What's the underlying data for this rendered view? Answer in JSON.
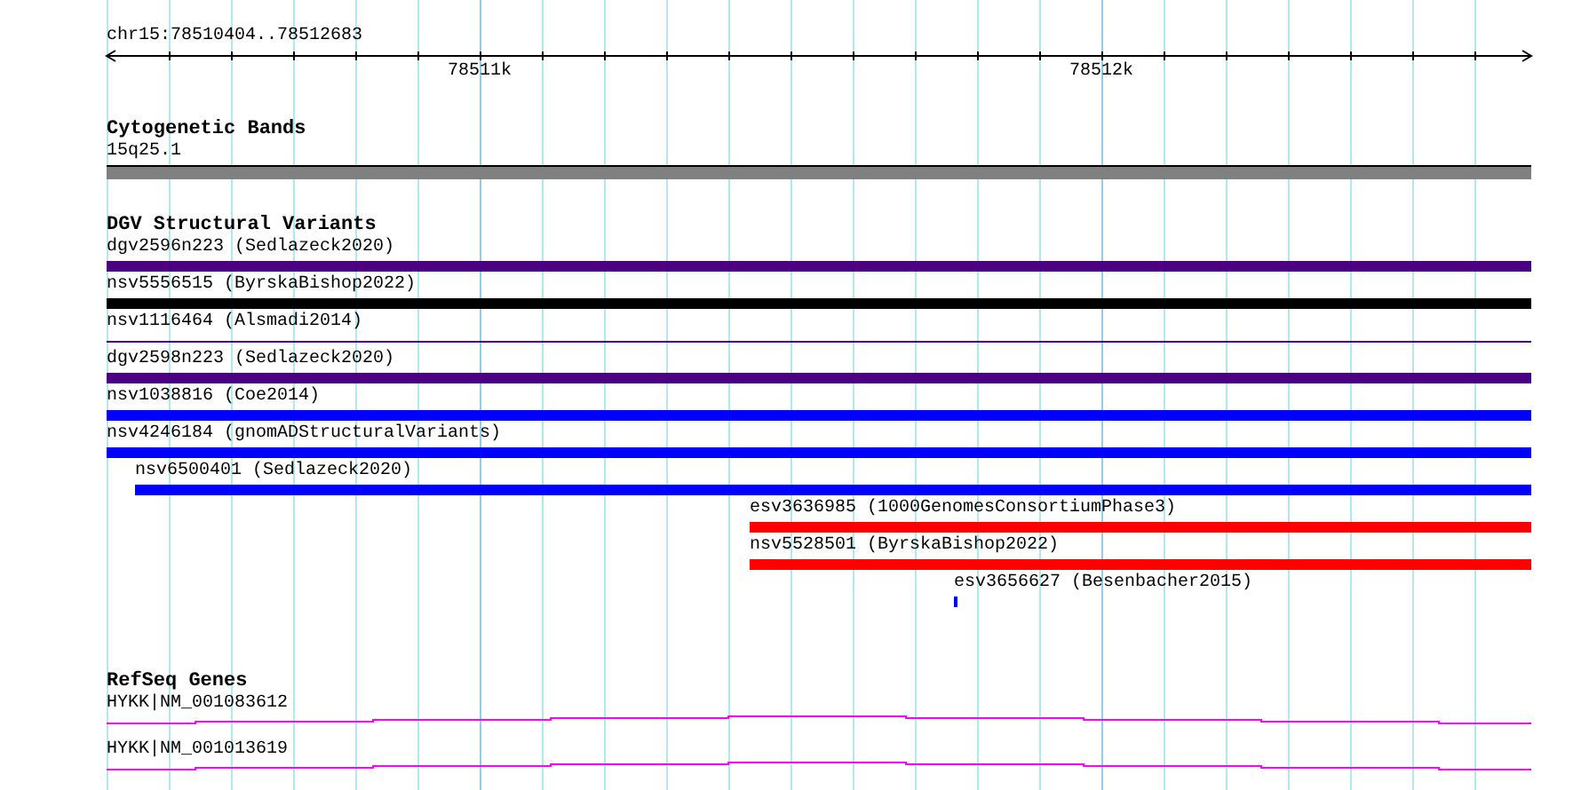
{
  "ruler": {
    "range_label": "chr15:78510404..78512683",
    "tick_labels": [
      "78511k",
      "78512k"
    ]
  },
  "tracks": [
    {
      "title": "Cytogenetic Bands",
      "kind": "bands",
      "features": [
        {
          "label": "15q25.1",
          "kind": "band",
          "color": "#808080"
        }
      ]
    },
    {
      "title": "DGV Structural Variants",
      "kind": "variants",
      "features": [
        {
          "label": "dgv2596n223 (Sedlazeck2020)",
          "kind": "bar",
          "color": "#4b0082"
        },
        {
          "label": "nsv5556515 (ByrskaBishop2022)",
          "kind": "bar",
          "color": "#000000"
        },
        {
          "label": "nsv1116464 (Alsmadi2014)",
          "kind": "line",
          "color": "#4b0082"
        },
        {
          "label": "dgv2598n223 (Sedlazeck2020)",
          "kind": "bar",
          "color": "#4b0082"
        },
        {
          "label": "nsv1038816 (Coe2014)",
          "kind": "bar",
          "color": "#0000ff"
        },
        {
          "label": "nsv4246184 (gnomADStructuralVariants)",
          "kind": "bar",
          "color": "#0000ff"
        },
        {
          "label": "nsv6500401 (Sedlazeck2020)",
          "kind": "bar",
          "color": "#0000ff"
        },
        {
          "label": "esv3636985 (1000GenomesConsortiumPhase3)",
          "kind": "bar",
          "color": "#ff0000"
        },
        {
          "label": "nsv5528501 (ByrskaBishop2022)",
          "kind": "bar",
          "color": "#ff0000"
        },
        {
          "label": "esv3656627 (Besenbacher2015)",
          "kind": "bar",
          "color": "#0000ff"
        }
      ]
    },
    {
      "title": "RefSeq Genes",
      "kind": "genes",
      "features": [
        {
          "label": "HYKK|NM_001083612",
          "kind": "transcript",
          "color": "#ff00ff"
        },
        {
          "label": "HYKK|NM_001013619",
          "kind": "transcript",
          "color": "#ff00ff"
        }
      ]
    }
  ]
}
